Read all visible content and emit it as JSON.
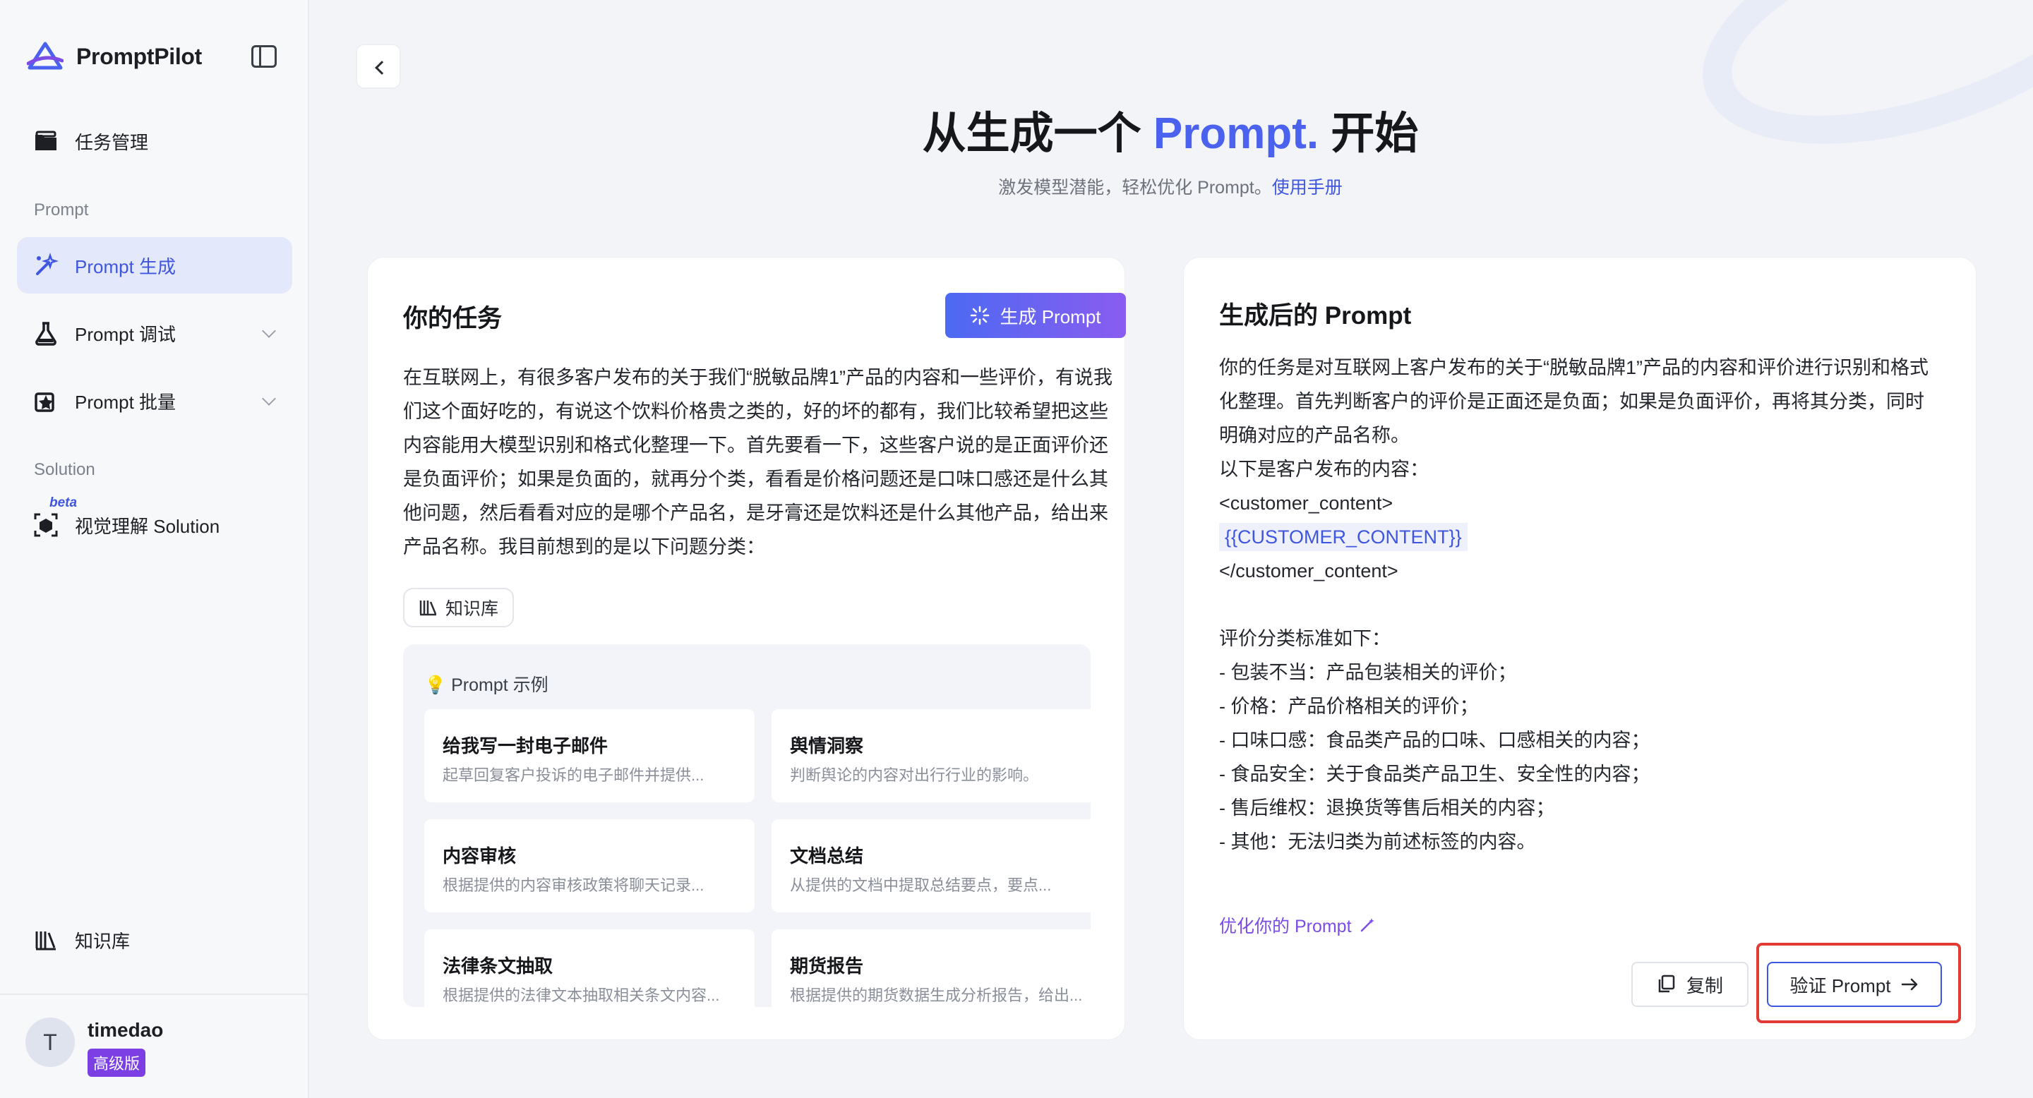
{
  "app": {
    "name": "PromptPilot"
  },
  "sidebar": {
    "task_mgmt": "任务管理",
    "section_prompt": "Prompt",
    "items": [
      {
        "label": "Prompt 生成",
        "icon": "sparkle-wand-icon",
        "active": true
      },
      {
        "label": "Prompt 调试",
        "icon": "flask-icon",
        "expandable": true
      },
      {
        "label": "Prompt 批量",
        "icon": "batch-star-icon",
        "expandable": true
      }
    ],
    "section_solution": "Solution",
    "solution_item": {
      "label": "视觉理解 Solution",
      "badge": "beta",
      "icon": "scan-cube-icon"
    },
    "knowledge_base": "知识库",
    "user": {
      "initial": "T",
      "name": "timedao",
      "plan": "高级版"
    }
  },
  "hero": {
    "title_prefix": "从生成一个 ",
    "title_accent": "Prompt.",
    "title_suffix": " 开始",
    "subtitle": "激发模型潜能，轻松优化 Prompt。",
    "subtitle_link": "使用手册"
  },
  "task_panel": {
    "title": "你的任务",
    "generate_button": "生成 Prompt",
    "task_text": "在互联网上，有很多客户发布的关于我们“脱敏品牌1”产品的内容和一些评价，有说我们这个面好吃的，有说这个饮料价格贵之类的，好的坏的都有，我们比较希望把这些内容能用大模型识别和格式化整理一下。首先要看一下，这些客户说的是正面评价还是负面评价；如果是负面的，就再分个类，看看是价格问题还是口味口感还是什么其他问题，然后看看对应的是哪个产品名，是牙膏还是饮料还是什么其他产品，给出来产品名称。我目前想到的是以下问题分类：",
    "kb_tag": "知识库",
    "examples_title": "Prompt 示例",
    "examples": [
      {
        "title": "给我写一封电子邮件",
        "desc": "起草回复客户投诉的电子邮件并提供..."
      },
      {
        "title": "舆情洞察",
        "desc": "判断舆论的内容对出行行业的影响。"
      },
      {
        "title": "内容审核",
        "desc": "根据提供的内容审核政策将聊天记录..."
      },
      {
        "title": "文档总结",
        "desc": "从提供的文档中提取总结要点，要点..."
      },
      {
        "title": "法律条文抽取",
        "desc": "根据提供的法律文本抽取相关条文内容..."
      },
      {
        "title": "期货报告",
        "desc": "根据提供的期货数据生成分析报告，给出..."
      }
    ]
  },
  "result_panel": {
    "title": "生成后的 Prompt",
    "line1": "你的任务是对互联网上客户发布的关于“脱敏品牌1”产品的内容和评价进行识别和格式化整理。首先判断客户的评价是正面还是负面；如果是负面评价，再将其分类，同时明确对应的产品名称。",
    "line2": "以下是客户发布的内容：",
    "tag_open": "<customer_content>",
    "variable": "{{CUSTOMER_CONTENT}}",
    "tag_close": "</customer_content>",
    "criteria_title": "评价分类标准如下：",
    "criteria": [
      "- 包装不当：产品包装相关的评价；",
      "- 价格：产品价格相关的评价；",
      "- 口味口感：食品类产品的口味、口感相关的内容；",
      "- 食品安全：关于食品类产品卫生、安全性的内容；",
      "- 售后维权：退换货等售后相关的内容；",
      "- 其他：无法归类为前述标签的内容。"
    ],
    "optimize_link": "优化你的 Prompt",
    "copy_button": "复制",
    "verify_button": "验证 Prompt"
  },
  "colors": {
    "accent": "#3f56e0",
    "purple": "#7b4de6",
    "highlight": "#e33a33"
  }
}
